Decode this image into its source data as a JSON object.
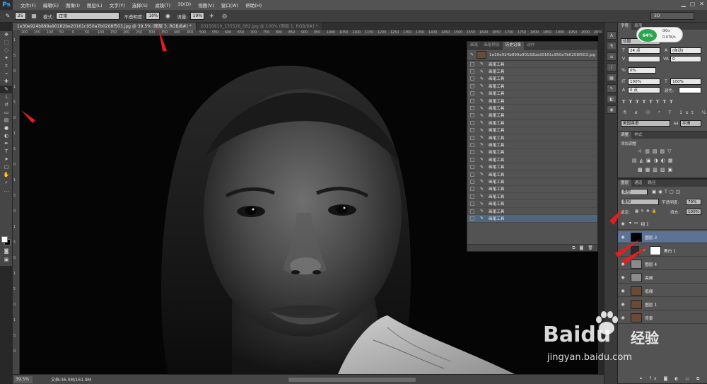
{
  "app": {
    "logo": "Ps"
  },
  "menubar": [
    "文件(F)",
    "编辑(E)",
    "图像(I)",
    "图层(L)",
    "文字(Y)",
    "选择(S)",
    "滤镜(T)",
    "3D(D)",
    "视图(V)",
    "窗口(W)",
    "帮助(H)"
  ],
  "options_bar": {
    "brush_size": "25",
    "mode_label": "模式:",
    "mode_value": "正常",
    "opacity_label": "不透明度:",
    "opacity_value": "10%",
    "flow_label": "流量:",
    "flow_value": "19%",
    "workspace": "3D"
  },
  "tabs": [
    {
      "label": "1e30e924b899a90182be20161c950a7b0208f503.jpg @ 39.5% (图层 3, RGB/8#) *",
      "active": true
    },
    {
      "label": "20150910_135526_062.jpg @ 100% (图层 1, RGB/8#) *",
      "active": false
    }
  ],
  "ruler_h": [
    "200",
    "150",
    "100",
    "50",
    "0",
    "50",
    "100",
    "150",
    "200",
    "250",
    "300",
    "350",
    "400",
    "450",
    "500",
    "550",
    "600",
    "650",
    "700",
    "750",
    "800",
    "850",
    "900",
    "950",
    "1000",
    "1050",
    "1100",
    "1150",
    "1200",
    "1250",
    "1300",
    "1350",
    "1400",
    "1450",
    "1500",
    "1550",
    "1600",
    "1650",
    "1700",
    "1750",
    "1800",
    "1850",
    "1900",
    "1950",
    "2000",
    "2050"
  ],
  "ruler_v": [
    "1",
    "5",
    "0",
    "1",
    "5",
    "0",
    "1",
    "5",
    "0",
    "1",
    "5",
    "0",
    "1",
    "5",
    "0",
    "1",
    "5",
    "0",
    "1",
    "5",
    "0"
  ],
  "status": {
    "zoom": "39.5%",
    "doc": "文档:36.0M/161.9M"
  },
  "history": {
    "tabs": [
      "画笔",
      "画笔预设",
      "历史记录",
      "动作"
    ],
    "active_tab": "历史记录",
    "snapshot_label": "1e30e924b899a90182be20161c950a7b0208f503.jpg",
    "entries": [
      "画笔工具",
      "画笔工具",
      "画笔工具",
      "画笔工具",
      "画笔工具",
      "画笔工具",
      "画笔工具",
      "画笔工具",
      "画笔工具",
      "画笔工具",
      "画笔工具",
      "画笔工具",
      "画笔工具",
      "画笔工具",
      "画笔工具",
      "画笔工具",
      "画笔工具",
      "画笔工具",
      "画笔工具",
      "画笔工具",
      "画笔工具",
      "画笔工具"
    ]
  },
  "network": {
    "percent": "64%",
    "up": "0K/s",
    "down": "0.07K/s"
  },
  "char_panel": {
    "tabs": [
      "字符",
      "段落"
    ],
    "font_family": "幼圆",
    "font_size": "24 点",
    "leading": "(自动)",
    "tracking": "0",
    "kerning": "0%",
    "vscale": "100%",
    "hscale": "100%",
    "baseline": "0 点",
    "color_label": "颜色:",
    "language": "美国英语",
    "aa": "平滑"
  },
  "adjust_panel": {
    "tabs": [
      "调整",
      "样式"
    ],
    "title": "添加调整"
  },
  "layers_panel": {
    "tabs": [
      "图层",
      "通道",
      "路径"
    ],
    "filter_label": "类型",
    "blend_mode": "叠加",
    "opacity_label": "不透明度:",
    "opacity_value": "79%",
    "lock_label": "锁定:",
    "fill_label": "填充:",
    "fill_value": "100%",
    "layers": [
      {
        "name": "组 1",
        "thumb": "#535353",
        "selected": false,
        "group": true
      },
      {
        "name": "图层 3",
        "thumb": "#000000",
        "selected": true,
        "group": false
      },
      {
        "name": "黑白 1",
        "thumb": "#ffffff",
        "selected": false,
        "group": false
      },
      {
        "name": "图层 4",
        "thumb": "#8a8a8a",
        "selected": false,
        "group": false
      },
      {
        "name": "高频",
        "thumb": "#8c8c8c",
        "selected": false,
        "group": false
      },
      {
        "name": "低频",
        "thumb": "#6a4a36",
        "selected": false,
        "group": false
      },
      {
        "name": "图层 1",
        "thumb": "#6a4a36",
        "selected": false,
        "group": false
      },
      {
        "name": "背景",
        "thumb": "#6a4a36",
        "selected": false,
        "group": false
      }
    ]
  },
  "watermark": {
    "brand": "Baidu",
    "brand_cn": "经验",
    "url": "jingyan.baidu.com"
  }
}
